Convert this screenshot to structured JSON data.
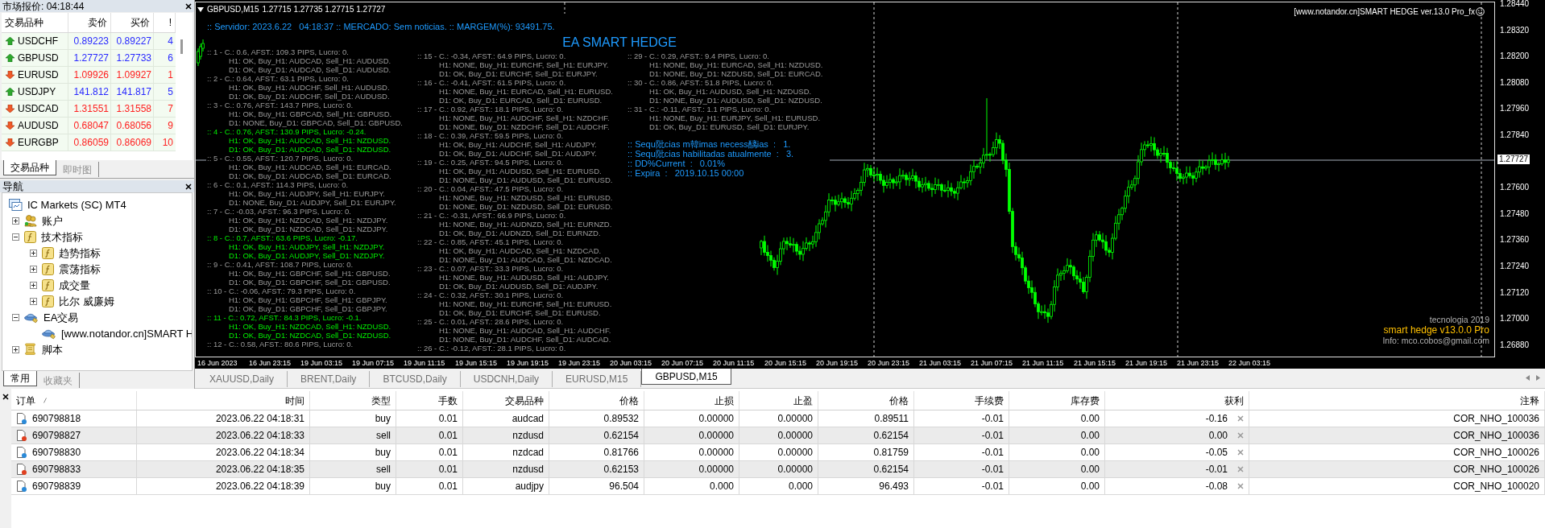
{
  "market_watch": {
    "title": "市场报价: 04:18:44",
    "columns": [
      "交易品种",
      "卖价",
      "买价",
      "!"
    ],
    "rows": [
      {
        "symbol": "USDCHF",
        "bid": "0.89223",
        "ask": "0.89227",
        "spread": "4",
        "rising": true
      },
      {
        "symbol": "GBPUSD",
        "bid": "1.27727",
        "ask": "1.27733",
        "spread": "6",
        "rising": true
      },
      {
        "symbol": "EURUSD",
        "bid": "1.09926",
        "ask": "1.09927",
        "spread": "1",
        "rising": false
      },
      {
        "symbol": "USDJPY",
        "bid": "141.812",
        "ask": "141.817",
        "spread": "5",
        "rising": true
      },
      {
        "symbol": "USDCAD",
        "bid": "1.31551",
        "ask": "1.31558",
        "spread": "7",
        "rising": false
      },
      {
        "symbol": "AUDUSD",
        "bid": "0.68047",
        "ask": "0.68056",
        "spread": "9",
        "rising": false
      },
      {
        "symbol": "EURGBP",
        "bid": "0.86059",
        "ask": "0.86069",
        "spread": "10",
        "rising": false
      }
    ],
    "tabs": [
      {
        "label": "交易品种",
        "selected": true
      },
      {
        "label": "即时图",
        "selected": false
      }
    ]
  },
  "navigator": {
    "title": "导航",
    "root": "IC Markets (SC) MT4",
    "items": [
      {
        "label": "账户",
        "kind": "accounts",
        "expanded": false
      },
      {
        "label": "技术指标",
        "kind": "indicator",
        "expanded": true,
        "children": [
          {
            "label": "趋势指标",
            "kind": "indicator",
            "expanded": false
          },
          {
            "label": "震荡指标",
            "kind": "indicator",
            "expanded": false
          },
          {
            "label": "成交量",
            "kind": "indicator",
            "expanded": false
          },
          {
            "label": "比尔 威廉姆",
            "kind": "indicator",
            "expanded": false
          }
        ]
      },
      {
        "label": "EA交易",
        "kind": "expert",
        "expanded": true,
        "children": [
          {
            "label": "[www.notandor.cn]SMART H",
            "kind": "expert"
          }
        ]
      },
      {
        "label": "脚本",
        "kind": "script",
        "expanded": false
      }
    ],
    "tabs": [
      {
        "label": "常用",
        "selected": true
      },
      {
        "label": "收藏夹",
        "selected": false
      }
    ]
  },
  "chart": {
    "symbol": "GBPUSD,M15",
    "quote": "1.27715 1.27735 1.27715 1.27727",
    "server_line": ":: Servidor: 2023.6.22   04:18:37 :: MERCADO: Sem noticias. :: MARGEM(%): 93491.75.",
    "title": "EA SMART HEDGE",
    "ea_label": "[www.notandor.cn]SMART HEDGE ver.13.0 Pro_fx",
    "columns": [
      [
        {
          "header": ":: 1 - C.: 0.6, AFST.: 109.3 PIPS, Lucro: 0.",
          "lines": [
            "H1: OK, Buy_H1: AUDCAD, Sell_H1: AUDUSD.",
            "D1: OK, Buy_D1: AUDCAD, Sell_D1: AUDUSD."
          ],
          "active": false
        },
        {
          "header": ":: 2 - C.: 0.64, AFST.: 63.1 PIPS, Lucro: 0.",
          "lines": [
            "H1: OK, Buy_H1: AUDCHF, Sell_H1: AUDUSD.",
            "D1: OK, Buy_D1: AUDCHF, Sell_D1: AUDUSD."
          ],
          "active": false
        },
        {
          "header": ":: 3 - C.: 0.76, AFST.: 143.7 PIPS, Lucro: 0.",
          "lines": [
            "H1: OK, Buy_H1: GBPCAD, Sell_H1: GBPUSD.",
            "D1: NONE, Buy_D1: GBPCAD, Sell_D1: GBPUSD."
          ],
          "active": false
        },
        {
          "header": ":: 4 - C.: 0.76, AFST.: 130.9 PIPS, Lucro: -0.24.",
          "lines": [
            "H1: OK, Buy_H1: AUDCAD, Sell_H1: NZDUSD.",
            "D1: OK, Buy_D1: AUDCAD, Sell_D1: NZDUSD."
          ],
          "active": true
        },
        {
          "header": ":: 5 - C.: 0.55, AFST.: 120.7 PIPS, Lucro: 0.",
          "lines": [
            "H1: OK, Buy_H1: AUDCAD, Sell_H1: EURCAD.",
            "D1: OK, Buy_D1: AUDCAD, Sell_D1: EURCAD."
          ],
          "active": false
        },
        {
          "header": ":: 6 - C.: 0.1, AFST.: 114.3 PIPS, Lucro: 0.",
          "lines": [
            "H1: OK, Buy_H1: AUDJPY, Sell_H1: EURJPY.",
            "D1: NONE, Buy_D1: AUDJPY, Sell_D1: EURJPY."
          ],
          "active": false
        },
        {
          "header": ":: 7 - C.: -0.03, AFST.: 96.3 PIPS, Lucro: 0.",
          "lines": [
            "H1: OK, Buy_H1: NZDCAD, Sell_H1: NZDJPY.",
            "D1: OK, Buy_D1: NZDCAD, Sell_D1: NZDJPY."
          ],
          "active": false
        },
        {
          "header": ":: 8 - C.: 0.7, AFST.: 63.6 PIPS, Lucro: -0.17.",
          "lines": [
            "H1: OK, Buy_H1: AUDJPY, Sell_H1: NZDJPY.",
            "D1: OK, Buy_D1: AUDJPY, Sell_D1: NZDJPY."
          ],
          "active": true
        },
        {
          "header": ":: 9 - C.: 0.41, AFST.: 108.7 PIPS, Lucro: 0.",
          "lines": [
            "H1: OK, Buy_H1: GBPCHF, Sell_H1: GBPUSD.",
            "D1: OK, Buy_D1: GBPCHF, Sell_D1: GBPUSD."
          ],
          "active": false
        },
        {
          "header": ":: 10 - C.: -0.06, AFST.: 79.3 PIPS, Lucro: 0.",
          "lines": [
            "H1: OK, Buy_H1: GBPCHF, Sell_H1: GBPJPY.",
            "D1: OK, Buy_D1: GBPCHF, Sell_D1: GBPJPY."
          ],
          "active": false
        },
        {
          "header": ":: 11 - C.: 0.72, AFST.: 84.3 PIPS, Lucro: -0.1.",
          "lines": [
            "H1: OK, Buy_H1: NZDCAD, Sell_H1: NZDUSD.",
            "D1: OK, Buy_D1: NZDCAD, Sell_D1: NZDUSD."
          ],
          "active": true
        },
        {
          "header": ":: 12 - C.: 0.58, AFST.: 80.6 PIPS, Lucro: 0.",
          "active": false
        }
      ],
      [
        {
          "header": ":: 15 - C.: -0.34, AFST.: 64.9 PIPS, Lucro: 0.",
          "lines": [
            "H1: NONE, Buy_H1: EURCHF, Sell_H1: EURJPY.",
            "D1: OK, Buy_D1: EURCHF, Sell_D1: EURJPY."
          ],
          "active": false
        },
        {
          "header": ":: 16 - C.: -0.41, AFST.: 61.5 PIPS, Lucro: 0.",
          "lines": [
            "H1: NONE, Buy_H1: EURCAD, Sell_H1: EURUSD.",
            "D1: OK, Buy_D1: EURCAD, Sell_D1: EURUSD."
          ],
          "active": false
        },
        {
          "header": ":: 17 - C.: 0.92, AFST.: 18.1 PIPS, Lucro: 0.",
          "lines": [
            "H1: NONE, Buy_H1: AUDCHF, Sell_H1: NZDCHF.",
            "D1: NONE, Buy_D1: NZDCHF, Sell_D1: AUDCHF."
          ],
          "active": false
        },
        {
          "header": ":: 18 - C.: 0.39, AFST.: 59.5 PIPS, Lucro: 0.",
          "lines": [
            "H1: OK, Buy_H1: AUDCHF, Sell_H1: AUDJPY.",
            "D1: OK, Buy_D1: AUDCHF, Sell_D1: AUDJPY."
          ],
          "active": false
        },
        {
          "header": ":: 19 - C.: 0.25, AFST.: 94.5 PIPS, Lucro: 0.",
          "lines": [
            "H1: OK, Buy_H1: AUDUSD, Sell_H1: EURUSD.",
            "D1: NONE, Buy_D1: AUDUSD, Sell_D1: EURUSD."
          ],
          "active": false
        },
        {
          "header": ":: 20 - C.: 0.04, AFST.: 47.5 PIPS, Lucro: 0.",
          "lines": [
            "H1: NONE, Buy_H1: NZDUSD, Sell_H1: EURUSD.",
            "D1: NONE, Buy_D1: NZDUSD, Sell_D1: EURUSD."
          ],
          "active": false
        },
        {
          "header": ":: 21 - C.: -0.31, AFST.: 66.9 PIPS, Lucro: 0.",
          "lines": [
            "H1: NONE, Buy_H1: AUDNZD, Sell_H1: EURNZD.",
            "D1: OK, Buy_D1: AUDNZD, Sell_D1: EURNZD."
          ],
          "active": false
        },
        {
          "header": ":: 22 - C.: 0.85, AFST.: 45.1 PIPS, Lucro: 0.",
          "lines": [
            "H1: OK, Buy_H1: AUDCAD, Sell_H1: NZDCAD.",
            "D1: NONE, Buy_D1: AUDCAD, Sell_D1: NZDCAD."
          ],
          "active": false
        },
        {
          "header": ":: 23 - C.: 0.07, AFST.: 33.3 PIPS, Lucro: 0.",
          "lines": [
            "H1: NONE, Buy_H1: AUDUSD, Sell_H1: AUDJPY.",
            "D1: OK, Buy_D1: AUDUSD, Sell_D1: AUDJPY."
          ],
          "active": false
        },
        {
          "header": ":: 24 - C.: 0.32, AFST.: 30.1 PIPS, Lucro: 0.",
          "lines": [
            "H1: NONE, Buy_H1: EURCHF, Sell_H1: EURUSD.",
            "D1: OK, Buy_D1: EURCHF, Sell_D1: EURUSD."
          ],
          "active": false
        },
        {
          "header": ":: 25 - C.: 0.01, AFST.: 28.6 PIPS, Lucro: 0.",
          "lines": [
            "H1: NONE, Buy_H1: AUDCAD, Sell_H1: AUDCHF.",
            "D1: NONE, Buy_D1: AUDCHF, Sell_D1: AUDCAD."
          ],
          "active": false
        },
        {
          "header": ":: 26 - C.: -0.12, AFST.: 28.1 PIPS, Lucro: 0.",
          "active": false
        }
      ],
      [
        {
          "header": ":: 29 - C.: 0.29, AFST.: 9.4 PIPS, Lucro: 0.",
          "lines": [
            "H1: NONE, Buy_H1: EURCAD, Sell_H1: NZDUSD.",
            "D1: NONE, Buy_D1: NZDUSD, Sell_D1: EURCAD."
          ],
          "active": false
        },
        {
          "header": ":: 30 - C.: 0.86, AFST.: 51.8 PIPS, Lucro: 0.",
          "lines": [
            "H1: OK, Buy_H1: AUDUSD, Sell_H1: NZDUSD.",
            "D1: NONE, Buy_D1: AUDUSD, Sell_D1: NZDUSD."
          ],
          "active": false
        },
        {
          "header": ":: 31 - C.: -0.11, AFST.: 1.1 PIPS, Lucro: 0.",
          "lines": [
            "H1: NONE, Buy_H1: EURJPY, Sell_H1: EURUSD.",
            "D1: OK, Buy_D1: EURUSD, Sell_D1: EURJPY."
          ],
          "active": false
        }
      ]
    ],
    "summary": [
      ":: Sequ阰cias m韓imas necess醨ias  :   1.",
      ":: Sequ阰cias habilitadas atualmente  :   3.",
      ":: DD%Current  :   0.01%",
      ":: Expira  :   2019.10.15 00:00"
    ],
    "footer": [
      {
        "text": "tecnologia 2019",
        "kind": "muted"
      },
      {
        "text": "smart hedge v13.0.0 Pro",
        "kind": "highlight"
      },
      {
        "text": "Info: mco.cobos@gmail.com",
        "kind": "muted"
      }
    ],
    "price_axis": [
      "1.28440",
      "1.28320",
      "1.28200",
      "1.28080",
      "1.27960",
      "1.27840",
      "1.27600",
      "1.27480",
      "1.27360",
      "1.27240",
      "1.27120",
      "1.27000",
      "1.26880"
    ],
    "current_price": "1.27727",
    "time_axis": [
      "16 Jun 2023",
      "16 Jun 23:15",
      "19 Jun 03:15",
      "19 Jun 07:15",
      "19 Jun 11:15",
      "19 Jun 15:15",
      "19 Jun 19:15",
      "19 Jun 23:15",
      "20 Jun 03:15",
      "20 Jun 07:15",
      "20 Jun 11:15",
      "20 Jun 15:15",
      "20 Jun 19:15",
      "20 Jun 23:15",
      "21 Jun 03:15",
      "21 Jun 07:15",
      "21 Jun 11:15",
      "21 Jun 15:15",
      "21 Jun 19:15",
      "21 Jun 23:15",
      "22 Jun 03:15"
    ]
  },
  "chart_tabs": [
    {
      "label": "XAUUSD,Daily",
      "selected": false
    },
    {
      "label": "BRENT,Daily",
      "selected": false
    },
    {
      "label": "BTCUSD,Daily",
      "selected": false
    },
    {
      "label": "USDCNH,Daily",
      "selected": false
    },
    {
      "label": "EURUSD,M15",
      "selected": false
    },
    {
      "label": "GBPUSD,M15",
      "selected": true
    }
  ],
  "trades": {
    "columns": [
      "订单",
      "时间",
      "类型",
      "手数",
      "交易品种",
      "价格",
      "止损",
      "止盈",
      "价格",
      "手续费",
      "库存费",
      "获利",
      "注释"
    ],
    "rows": [
      {
        "kind": "buy",
        "cells": [
          "690798818",
          "2023.06.22 04:18:31",
          "buy",
          "0.01",
          "audcad",
          "0.89532",
          "0.00000",
          "0.00000",
          "0.89511",
          "-0.01",
          "0.00",
          "-0.16",
          "COR_NHO_100036"
        ]
      },
      {
        "kind": "sell",
        "cells": [
          "690798827",
          "2023.06.22 04:18:33",
          "sell",
          "0.01",
          "nzdusd",
          "0.62154",
          "0.00000",
          "0.00000",
          "0.62154",
          "-0.01",
          "0.00",
          "0.00",
          "COR_NHO_100036"
        ]
      },
      {
        "kind": "buy",
        "cells": [
          "690798830",
          "2023.06.22 04:18:34",
          "buy",
          "0.01",
          "nzdcad",
          "0.81766",
          "0.00000",
          "0.00000",
          "0.81759",
          "-0.01",
          "0.00",
          "-0.05",
          "COR_NHO_100026"
        ]
      },
      {
        "kind": "sell",
        "cells": [
          "690798833",
          "2023.06.22 04:18:35",
          "sell",
          "0.01",
          "nzdusd",
          "0.62153",
          "0.00000",
          "0.00000",
          "0.62154",
          "-0.01",
          "0.00",
          "-0.01",
          "COR_NHO_100026"
        ]
      },
      {
        "kind": "buy",
        "cells": [
          "690798839",
          "2023.06.22 04:18:39",
          "buy",
          "0.01",
          "audjpy",
          "96.504",
          "0.000",
          "0.000",
          "96.493",
          "-0.01",
          "0.00",
          "-0.08",
          "COR_NHO_100020"
        ]
      }
    ]
  }
}
